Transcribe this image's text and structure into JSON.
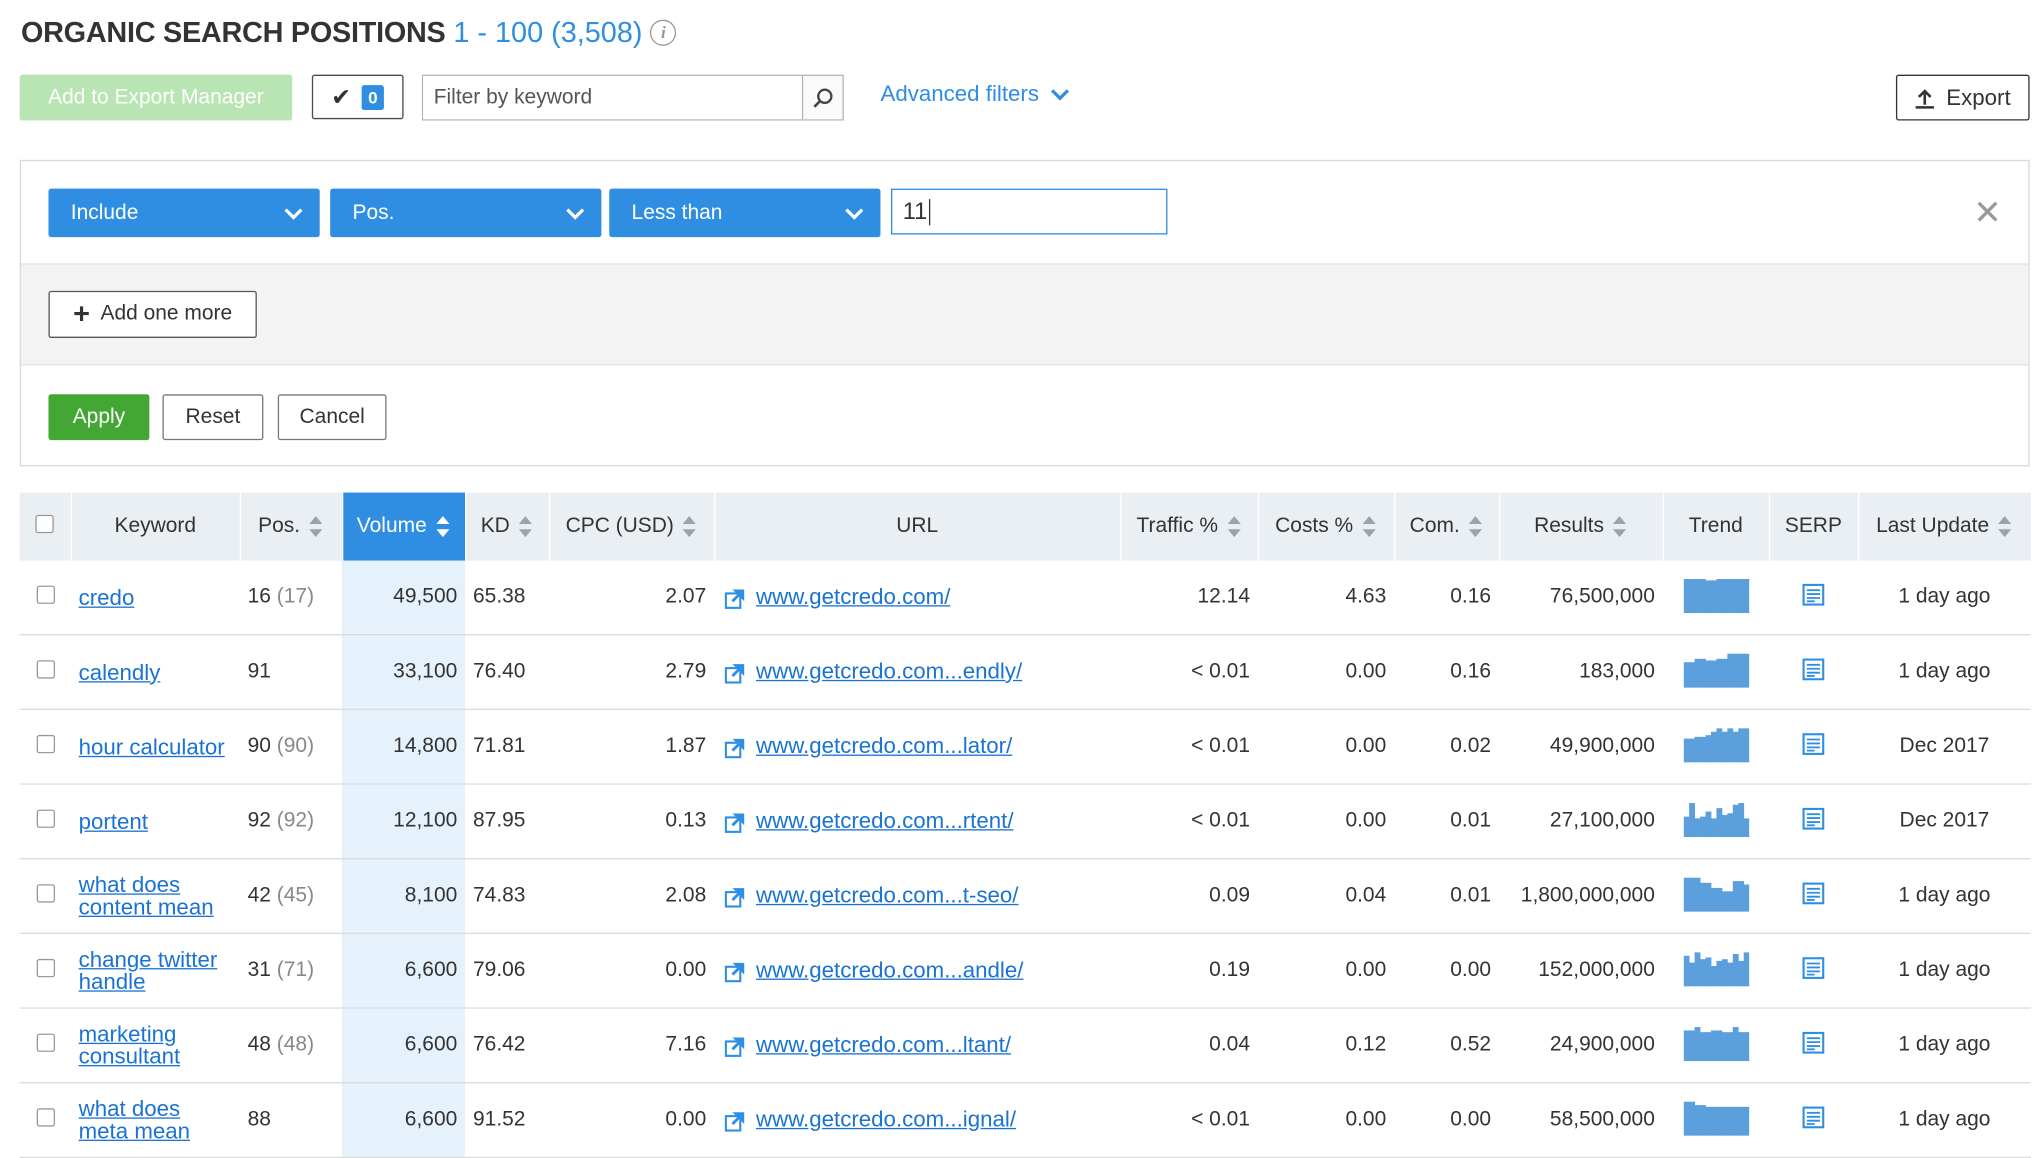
{
  "header": {
    "title": "ORGANIC SEARCH POSITIONS",
    "range": "1 - 100 (3,508)",
    "info_glyph": "i"
  },
  "toolbar": {
    "export_manager_label": "Add to Export Manager",
    "selected_count": "0",
    "search_placeholder": "Filter by keyword",
    "advanced_filters_label": "Advanced filters",
    "export_label": "Export"
  },
  "filter": {
    "include": "Include",
    "field": "Pos.",
    "condition": "Less than",
    "value": "11",
    "add_one_more": "Add one more",
    "apply": "Apply",
    "reset": "Reset",
    "cancel": "Cancel"
  },
  "table": {
    "columns": {
      "keyword": "Keyword",
      "pos": "Pos.",
      "volume": "Volume",
      "kd": "KD",
      "cpc": "CPC (USD)",
      "url": "URL",
      "traffic": "Traffic %",
      "costs": "Costs %",
      "com": "Com.",
      "results": "Results",
      "trend": "Trend",
      "serp": "SERP",
      "last_update": "Last Update"
    },
    "sorted_column": "Volume",
    "rows": [
      {
        "keyword": "credo",
        "pos": "16",
        "prev_pos": "(17)",
        "volume": "49,500",
        "kd": "65.38",
        "cpc": "2.07",
        "url": "www.getcredo.com/",
        "traffic": "12.14",
        "costs": "4.63",
        "com": "0.16",
        "results": "76,500,000",
        "trend": [
          1,
          1,
          1,
          1,
          0.96,
          0.96,
          1,
          1,
          1,
          1,
          1,
          1
        ],
        "last_update": "1 day ago"
      },
      {
        "keyword": "calendly",
        "pos": "91",
        "prev_pos": "",
        "volume": "33,100",
        "kd": "76.40",
        "cpc": "2.79",
        "url": "www.getcredo.com...endly/",
        "traffic": "< 0.01",
        "costs": "0.00",
        "com": "0.16",
        "results": "183,000",
        "trend": [
          0.75,
          0.75,
          0.85,
          0.85,
          0.8,
          0.8,
          0.85,
          0.85,
          1,
          1,
          1,
          1
        ],
        "last_update": "1 day ago"
      },
      {
        "keyword": "hour calculator",
        "pos": "90",
        "prev_pos": "(90)",
        "volume": "14,800",
        "kd": "71.81",
        "cpc": "1.87",
        "url": "www.getcredo.com...lator/",
        "traffic": "< 0.01",
        "costs": "0.00",
        "com": "0.02",
        "results": "49,900,000",
        "trend": [
          0.7,
          0.7,
          0.75,
          0.75,
          0.8,
          0.9,
          1,
          0.9,
          1,
          0.9,
          1,
          1
        ],
        "last_update": "Dec 2017"
      },
      {
        "keyword": "portent",
        "pos": "92",
        "prev_pos": "(92)",
        "volume": "12,100",
        "kd": "87.95",
        "cpc": "0.13",
        "url": "www.getcredo.com...rtent/",
        "traffic": "< 0.01",
        "costs": "0.00",
        "com": "0.01",
        "results": "27,100,000",
        "trend": [
          0.6,
          1,
          0.55,
          0.6,
          0.75,
          0.55,
          0.85,
          0.65,
          0.7,
          0.95,
          1,
          0.55
        ],
        "last_update": "Dec 2017"
      },
      {
        "keyword": "what does content mean",
        "pos": "42",
        "prev_pos": "(45)",
        "volume": "8,100",
        "kd": "74.83",
        "cpc": "2.08",
        "url": "www.getcredo.com...t-seo/",
        "traffic": "0.09",
        "costs": "0.04",
        "com": "0.01",
        "results": "1,800,000,000",
        "trend": [
          1,
          1,
          1,
          0.85,
          0.85,
          0.7,
          0.7,
          0.6,
          0.6,
          0.9,
          0.9,
          0.8
        ],
        "last_update": "1 day ago"
      },
      {
        "keyword": "change twitter handle",
        "pos": "31",
        "prev_pos": "(71)",
        "volume": "6,600",
        "kd": "79.06",
        "cpc": "0.00",
        "url": "www.getcredo.com...andle/",
        "traffic": "0.19",
        "costs": "0.00",
        "com": "0.00",
        "results": "152,000,000",
        "trend": [
          0.9,
          0.7,
          1,
          0.8,
          0.85,
          0.6,
          0.75,
          0.8,
          0.7,
          0.95,
          0.75,
          1
        ],
        "last_update": "1 day ago"
      },
      {
        "keyword": "marketing consultant",
        "pos": "48",
        "prev_pos": "(48)",
        "volume": "6,600",
        "kd": "76.42",
        "cpc": "7.16",
        "url": "www.getcredo.com...ltant/",
        "traffic": "0.04",
        "costs": "0.12",
        "com": "0.52",
        "results": "24,900,000",
        "trend": [
          0.9,
          0.9,
          1,
          0.85,
          0.85,
          0.9,
          0.9,
          0.85,
          0.85,
          1,
          0.85,
          0.85
        ],
        "last_update": "1 day ago"
      },
      {
        "keyword": "what does meta mean",
        "pos": "88",
        "prev_pos": "",
        "volume": "6,600",
        "kd": "91.52",
        "cpc": "0.00",
        "url": "www.getcredo.com...ignal/",
        "traffic": "< 0.01",
        "costs": "0.00",
        "com": "0.00",
        "results": "58,500,000",
        "trend": [
          1,
          1,
          0.9,
          0.9,
          0.85,
          0.85,
          0.85,
          0.85,
          0.85,
          0.85,
          0.85,
          0.85
        ],
        "last_update": "1 day ago"
      }
    ]
  },
  "colors": {
    "accent": "#2f8ee1",
    "apply": "#43a833",
    "link": "#1a73d2",
    "volume_highlight": "#e5f1fb",
    "header_bg": "#eaeff4"
  }
}
